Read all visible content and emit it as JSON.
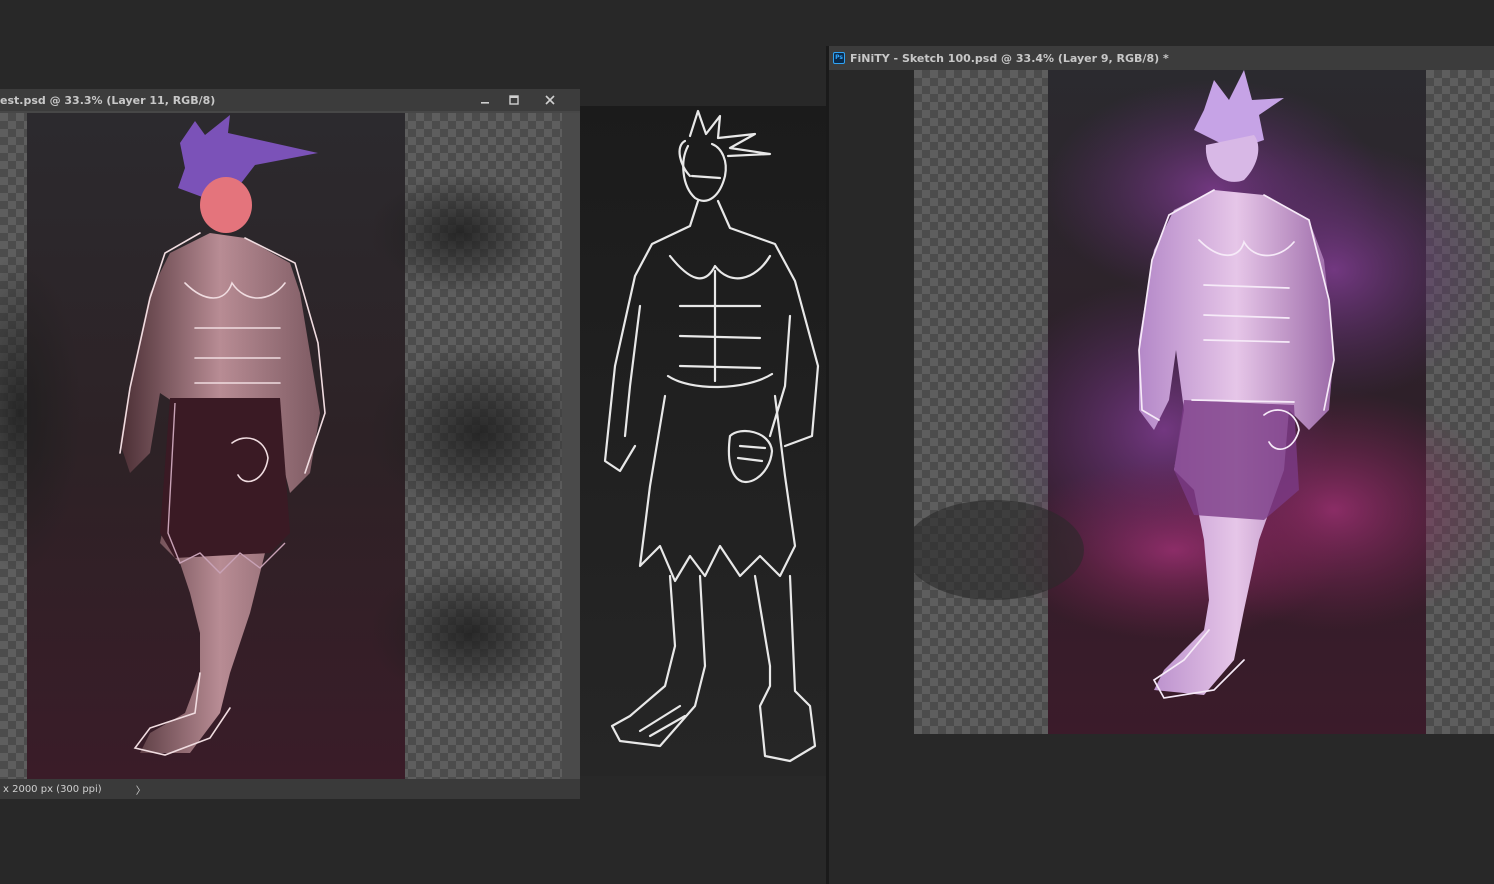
{
  "windows": {
    "left": {
      "title": "est.psd @ 33.3% (Layer 11, RGB/8)",
      "status": "x 2000 px (300 ppi)",
      "status_arrow": "〉",
      "minimize_icon": "minimize-icon",
      "maximize_icon": "maximize-icon",
      "close_icon": "close-icon"
    },
    "right": {
      "title": "FiNiTY - Sketch 100.psd @ 33.4% (Layer 9, RGB/8) *",
      "app_icon": "Ps"
    }
  },
  "colors": {
    "app_bg": "#282828",
    "titlebar_bg": "#3c3c3c",
    "hair_purple": "#9a6ad6",
    "skin_pink": "#d49aa0",
    "glow_violet": "#c89ae0"
  }
}
